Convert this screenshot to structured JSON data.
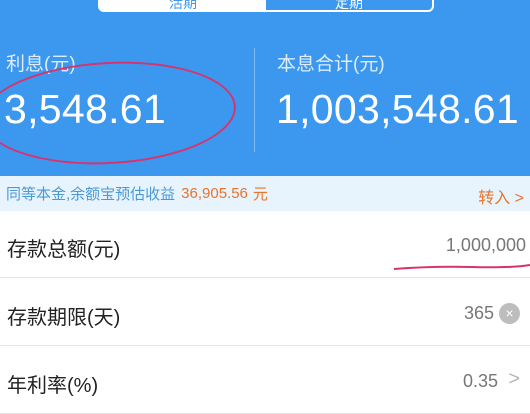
{
  "tabs": [
    {
      "label": "活期",
      "active": true
    },
    {
      "label": "定期",
      "active": false
    }
  ],
  "summary": {
    "interest_label": "利息(元)",
    "interest_value": "3,548.61",
    "total_label": "本息合计(元)",
    "total_value": "1,003,548.61"
  },
  "promo": {
    "text": "同等本金,余额宝预估收益",
    "amount": "36,905.56",
    "unit": "元",
    "link": "转入 >"
  },
  "rows": [
    {
      "label": "存款总额(元)",
      "value": "1,000,000"
    },
    {
      "label": "存款期限(天)",
      "value": "365",
      "icon": "clear-icon"
    },
    {
      "label": "年利率(%)",
      "value": "0.35",
      "icon": "chevron-right-icon"
    }
  ],
  "colors": {
    "header_bg": "#3c98ef",
    "promo_bg": "#e7f3fd",
    "accent_orange": "#e8742a",
    "annotation_red": "#d8336d"
  }
}
